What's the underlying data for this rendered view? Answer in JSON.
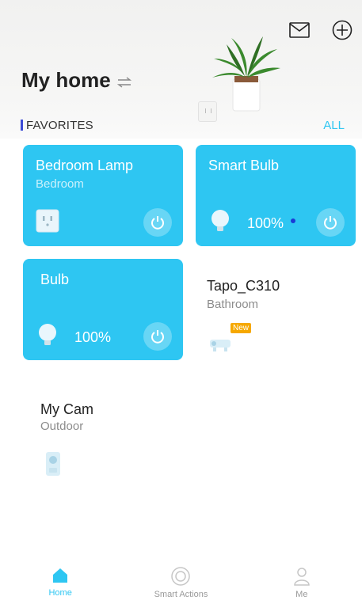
{
  "header": {
    "title": "My home",
    "mail_icon": "mail-icon",
    "add_icon": "add-circle-icon",
    "swap_icon": "swap-icon"
  },
  "favorites": {
    "label": "FAVORITES",
    "all_label": "ALL"
  },
  "devices": [
    {
      "name": "Bedroom Lamp",
      "room": "Bedroom",
      "icon": "smart-plug-icon",
      "state": "on"
    },
    {
      "name": "Smart Bulb",
      "room": "",
      "icon": "bulb-icon",
      "brightness": "100%",
      "state": "on"
    },
    {
      "name": "Bulb",
      "room": "",
      "icon": "bulb-icon",
      "brightness": "100%",
      "state": "on"
    },
    {
      "name": "Tapo_C310",
      "room": "Bathroom",
      "icon": "outdoor-camera-icon",
      "badge": "New",
      "state": "off"
    },
    {
      "name": "My Cam",
      "room": "Outdoor",
      "icon": "camera-icon",
      "state": "off"
    }
  ],
  "tabbar": {
    "tabs": [
      {
        "label": "Home",
        "icon": "home-icon",
        "active": true
      },
      {
        "label": "Smart Actions",
        "icon": "smart-actions-icon",
        "active": false
      },
      {
        "label": "Me",
        "icon": "user-icon",
        "active": false
      }
    ]
  },
  "colors": {
    "accent": "#2ec6f2",
    "favorites_marker": "#3c4bd6",
    "badge": "#f6a800"
  }
}
